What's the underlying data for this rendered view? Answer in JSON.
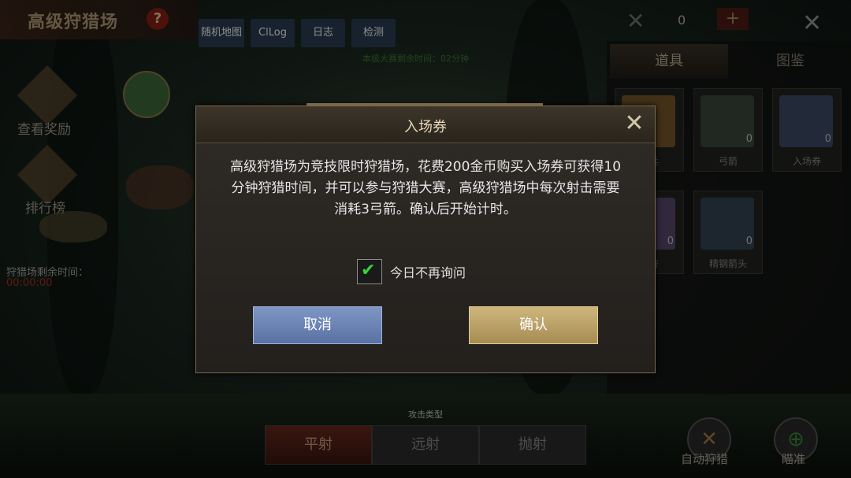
{
  "header": {
    "title": "高级狩猎场",
    "help": "?"
  },
  "debug_buttons": [
    "随机地图",
    "ClLog",
    "日志",
    "检测"
  ],
  "contest_timer": "本级大赛剩余时间：02分钟",
  "currency": {
    "count": "0",
    "plus": "+"
  },
  "right_panel": {
    "tabs": [
      "道具",
      "图鉴"
    ],
    "items": [
      {
        "name": "…兵",
        "count": ""
      },
      {
        "name": "弓箭",
        "count": "0"
      },
      {
        "name": "入场券",
        "count": "0"
      },
      {
        "name": "…杏",
        "count": "0"
      },
      {
        "name": "精钢箭头",
        "count": "0"
      }
    ]
  },
  "left_side": {
    "reward_label": "查看奖励",
    "rank_label": "排行榜",
    "hunt_time_label": "狩猎场剩余时间：",
    "hunt_time_value": "00:00:00"
  },
  "bottom": {
    "attack_type_label": "攻击类型",
    "shoot_modes": [
      "平射",
      "远射",
      "抛射"
    ],
    "auto_hunt_label": "自动狩猎",
    "aim_label": "瞄准"
  },
  "dialog": {
    "title": "入场券",
    "body": "高级狩猎场为竞技限时狩猎场，花费200金币购买入场券可获得10分钟狩猎时间，并可以参与狩猎大赛，高级狩猎场中每次射击需要消耗3弓箭。确认后开始计时。",
    "checkbox_label": "今日不再询问",
    "checkbox_checked": true,
    "cancel_label": "取消",
    "confirm_label": "确认"
  },
  "colors": {
    "accent_gold": "#cdb67c",
    "cancel_blue": "#7e96c4",
    "check_green": "#3ad13a"
  }
}
